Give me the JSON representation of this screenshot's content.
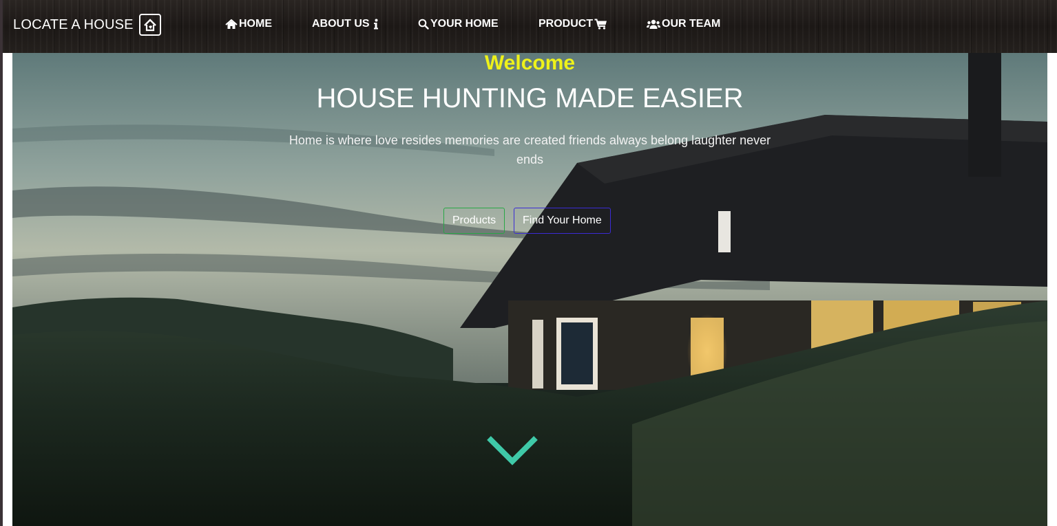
{
  "navbar": {
    "brand": "LOCATE A HOUSE",
    "brand_icon": "house-logo-icon",
    "items": [
      {
        "label": "HOME",
        "icon": "home-icon"
      },
      {
        "label": "ABOUT US",
        "icon": "info-icon"
      },
      {
        "label": "YOUR HOME",
        "icon": "search-icon"
      },
      {
        "label": "PRODUCT",
        "icon": "cart-icon"
      },
      {
        "label": "OUR TEAM",
        "icon": "users-icon"
      }
    ]
  },
  "hero": {
    "welcome": "Welcome",
    "headline": "HOUSE HUNTING MADE EASIER",
    "tagline": "Home is where love resides memories are created friends always belong laughter never ends",
    "buttons": {
      "products": "Products",
      "find_home": "Find Your Home"
    },
    "scroll_icon": "chevron-down-icon"
  },
  "colors": {
    "welcome": "#eef21a",
    "products_border": "#28a745",
    "find_border": "#3b2bd6",
    "chevron": "#3fc9a8"
  }
}
